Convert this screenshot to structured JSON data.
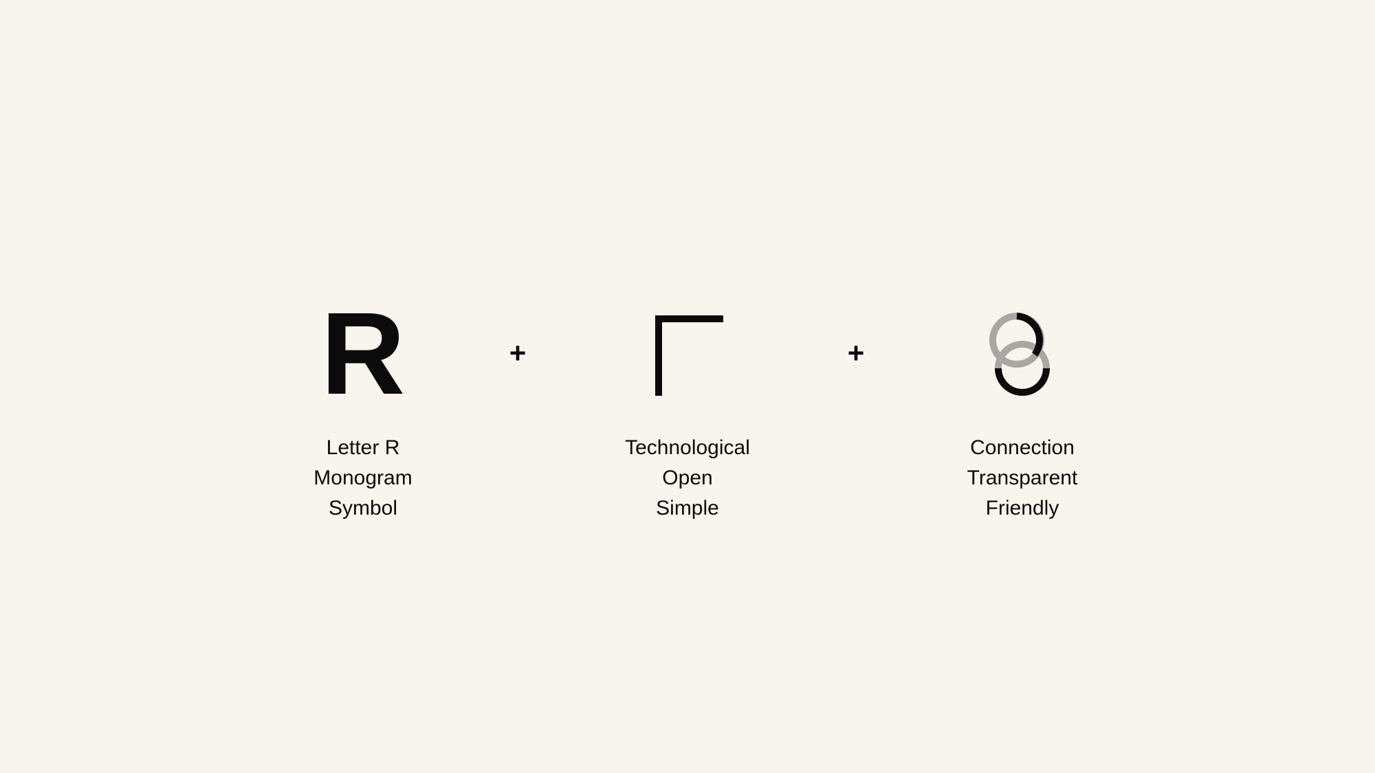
{
  "items": [
    {
      "glyph": "R",
      "labels": [
        "Letter R",
        "Monogram",
        "Symbol"
      ]
    },
    {
      "icon": "corner-bracket-icon",
      "labels": [
        "Technological",
        "Open",
        "Simple"
      ]
    },
    {
      "icon": "linked-rings-icon",
      "labels": [
        "Connection",
        "Transparent",
        "Friendly"
      ]
    }
  ],
  "operators": [
    "+",
    "+"
  ],
  "colors": {
    "background": "#f8f4ee",
    "foreground": "#0b0b0b",
    "ring_secondary": "#a9a7a3"
  }
}
